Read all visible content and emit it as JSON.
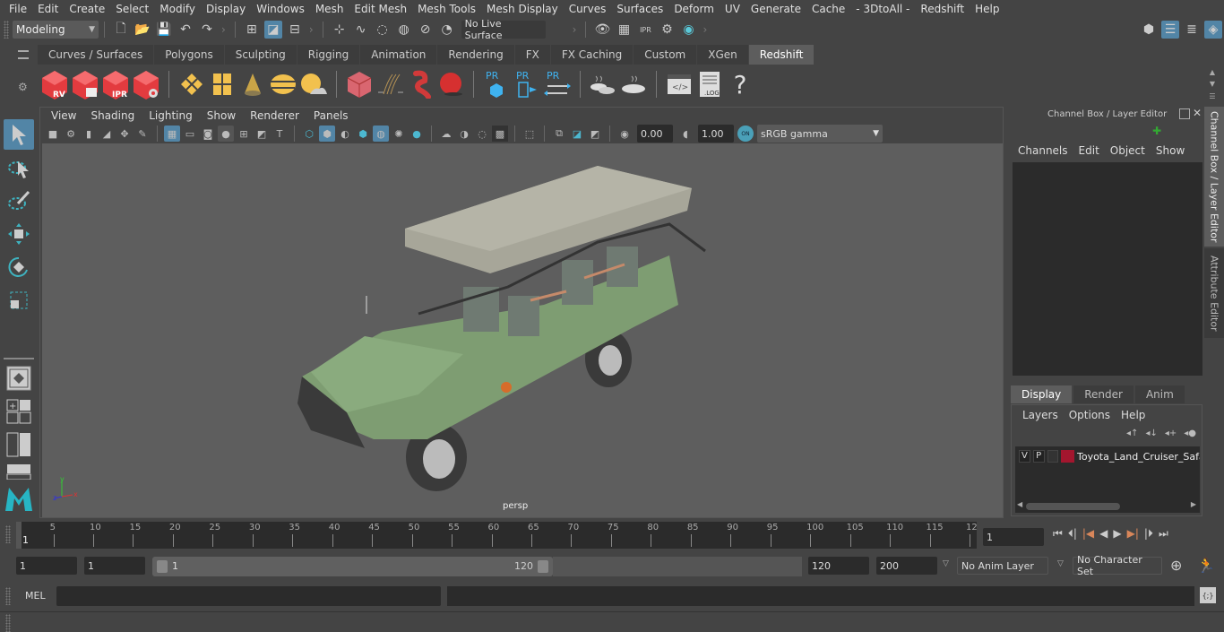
{
  "menubar": {
    "items": [
      "File",
      "Edit",
      "Create",
      "Select",
      "Modify",
      "Display",
      "Windows",
      "Mesh",
      "Edit Mesh",
      "Mesh Tools",
      "Mesh Display",
      "Curves",
      "Surfaces",
      "Deform",
      "UV",
      "Generate",
      "Cache",
      "- 3DtoAll -",
      "Redshift",
      "Help"
    ]
  },
  "statusline": {
    "mode": "Modeling",
    "live_surface": "No Live Surface"
  },
  "shelf": {
    "tabs": [
      "Curves / Surfaces",
      "Polygons",
      "Sculpting",
      "Rigging",
      "Animation",
      "Rendering",
      "FX",
      "FX Caching",
      "Custom",
      "XGen",
      "Redshift"
    ],
    "active_tab": "Redshift",
    "icons": {
      "rv": "RV",
      "ipr": "IPR",
      "pr": "PR",
      "log": ".LOG",
      "help": "?"
    }
  },
  "viewport": {
    "menu": [
      "View",
      "Shading",
      "Lighting",
      "Show",
      "Renderer",
      "Panels"
    ],
    "exposure": "0.00",
    "gamma": "1.00",
    "color_mgmt_toggle": "ON",
    "color_space": "sRGB gamma",
    "camera_label": "persp",
    "axis": {
      "x": "x",
      "y": "y",
      "z": "z"
    }
  },
  "channel_box": {
    "title": "Channel Box / Layer Editor",
    "menu": [
      "Channels",
      "Edit",
      "Object",
      "Show"
    ],
    "layer_tabs": [
      "Display",
      "Render",
      "Anim"
    ],
    "active_layer_tab": "Display",
    "layer_menu": [
      "Layers",
      "Options",
      "Help"
    ],
    "layers": [
      {
        "v": "V",
        "p": "P",
        "color": "#a3162e",
        "name": "Toyota_Land_Cruiser_Safari"
      }
    ]
  },
  "side_tabs": [
    "Channel Box / Layer Editor",
    "Attribute Editor"
  ],
  "timeline": {
    "ticks": [
      "5",
      "10",
      "15",
      "20",
      "25",
      "30",
      "35",
      "40",
      "45",
      "50",
      "55",
      "60",
      "65",
      "70",
      "75",
      "80",
      "85",
      "90",
      "95",
      "100",
      "105",
      "110",
      "115",
      "12"
    ],
    "current_frame_marker": "1",
    "current_frame": "1"
  },
  "range": {
    "start": "1",
    "playback_start": "1",
    "slider_start": "1",
    "slider_end": "120",
    "playback_end": "120",
    "end": "200",
    "anim_layer": "No Anim Layer",
    "character_set": "No Character Set"
  },
  "cmdline": {
    "label": "MEL"
  },
  "colors": {
    "accent": "#5285a6",
    "redshift_red": "#e33b3f",
    "gold": "#f2c14e",
    "pr_blue": "#3fb3f0",
    "layer_color": "#a3162e"
  }
}
